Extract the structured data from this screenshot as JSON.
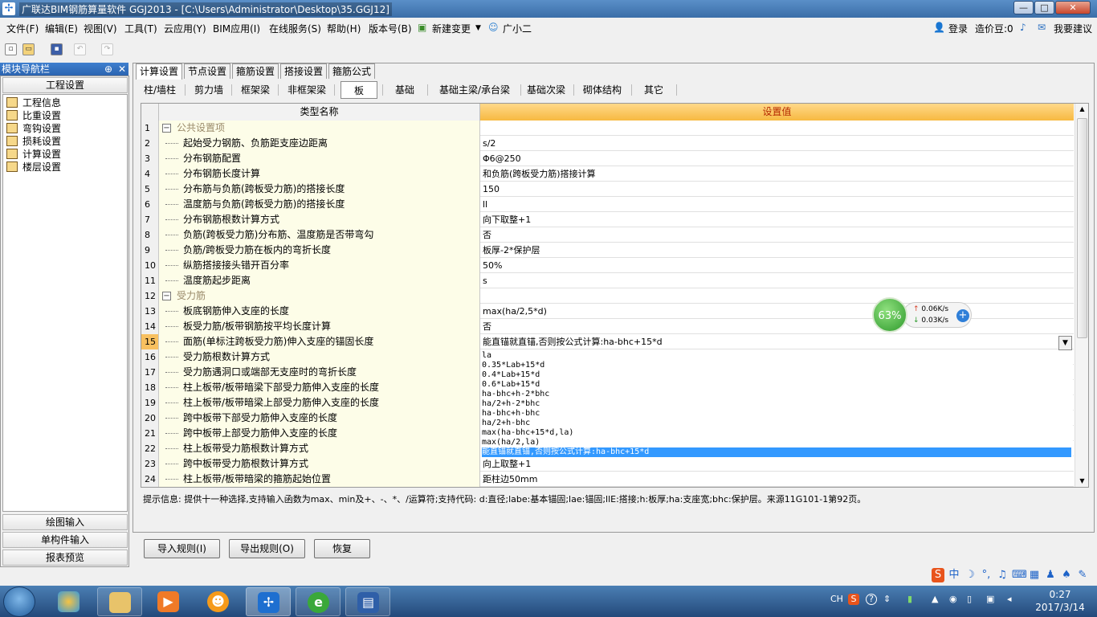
{
  "window": {
    "title": "广联达BIM钢筋算量软件 GGJ2013 - [C:\\Users\\Administrator\\Desktop\\35.GGJ12]",
    "min": "—",
    "max": "□",
    "close": "✕"
  },
  "menu": [
    "文件(F)",
    "编辑(E)",
    "视图(V)",
    "工具(T)",
    "云应用(Y)",
    "BIM应用(I)",
    "在线服务(S)",
    "帮助(H)",
    "版本号(B)",
    "新建变更",
    "广小二"
  ],
  "account": {
    "login": "登录",
    "price_bean": "造价豆:0",
    "suggest": "我要建议"
  },
  "nav": {
    "title": "模块导航栏",
    "pin": "⊕",
    "close": "✕",
    "section_project": "工程设置",
    "items": [
      "工程信息",
      "比重设置",
      "弯钩设置",
      "损耗设置",
      "计算设置",
      "楼层设置"
    ],
    "section_drawing": "绘图输入",
    "section_single": "单构件输入",
    "section_report": "报表预览"
  },
  "tabs": [
    "计算设置",
    "节点设置",
    "箍筋设置",
    "搭接设置",
    "箍筋公式"
  ],
  "subtabs": [
    "柱/墙柱",
    "剪力墙",
    "框架梁",
    "非框架梁",
    "板",
    "基础",
    "基础主梁/承台梁",
    "基础次梁",
    "砌体结构",
    "其它"
  ],
  "grid": {
    "header_name": "类型名称",
    "header_value": "设置值",
    "rows": [
      {
        "num": "1",
        "name": "公共设置项",
        "value": "",
        "group": true
      },
      {
        "num": "2",
        "name": "起始受力钢筋、负筋距支座边距离",
        "value": "s/2"
      },
      {
        "num": "3",
        "name": "分布钢筋配置",
        "value": "Φ6@250"
      },
      {
        "num": "4",
        "name": "分布钢筋长度计算",
        "value": "和负筋(跨板受力筋)搭接计算"
      },
      {
        "num": "5",
        "name": "分布筋与负筋(跨板受力筋)的搭接长度",
        "value": "150"
      },
      {
        "num": "6",
        "name": "温度筋与负筋(跨板受力筋)的搭接长度",
        "value": "ll"
      },
      {
        "num": "7",
        "name": "分布钢筋根数计算方式",
        "value": "向下取整+1"
      },
      {
        "num": "8",
        "name": "负筋(跨板受力筋)分布筋、温度筋是否带弯勾",
        "value": "否"
      },
      {
        "num": "9",
        "name": "负筋/跨板受力筋在板内的弯折长度",
        "value": "板厚-2*保护层"
      },
      {
        "num": "10",
        "name": "纵筋搭接接头错开百分率",
        "value": "50%"
      },
      {
        "num": "11",
        "name": "温度筋起步距离",
        "value": "s"
      },
      {
        "num": "12",
        "name": "受力筋",
        "value": "",
        "group": true
      },
      {
        "num": "13",
        "name": "板底钢筋伸入支座的长度",
        "value": "max(ha/2,5*d)"
      },
      {
        "num": "14",
        "name": "板受力筋/板带钢筋按平均长度计算",
        "value": "否"
      },
      {
        "num": "15",
        "name": "面筋(单标注跨板受力筋)伸入支座的锚固长度",
        "value": "能直锚就直锚,否则按公式计算:ha-bhc+15*d",
        "selected": true
      },
      {
        "num": "16",
        "name": "受力筋根数计算方式",
        "value": ""
      },
      {
        "num": "17",
        "name": "受力筋遇洞口或端部无支座时的弯折长度",
        "value": ""
      },
      {
        "num": "18",
        "name": "柱上板带/板带暗梁下部受力筋伸入支座的长度",
        "value": ""
      },
      {
        "num": "19",
        "name": "柱上板带/板带暗梁上部受力筋伸入支座的长度",
        "value": ""
      },
      {
        "num": "20",
        "name": "跨中板带下部受力筋伸入支座的长度",
        "value": ""
      },
      {
        "num": "21",
        "name": "跨中板带上部受力筋伸入支座的长度",
        "value": ""
      },
      {
        "num": "22",
        "name": "柱上板带受力筋根数计算方式",
        "value": ""
      },
      {
        "num": "23",
        "name": "跨中板带受力筋根数计算方式",
        "value": "向上取整+1"
      },
      {
        "num": "24",
        "name": "柱上板带/板带暗梁的箍筋起始位置",
        "value": "距柱边50mm"
      }
    ]
  },
  "dropdown_options": [
    "la",
    "0.35*Lab+15*d",
    "0.4*Lab+15*d",
    "0.6*Lab+15*d",
    "ha-bhc+h-2*bhc",
    "ha/2+h-2*bhc",
    "ha-bhc+h-bhc",
    "ha/2+h-bhc",
    "max(ha-bhc+15*d,la)",
    "max(ha/2,la)",
    "能直锚就直锚,否则按公式计算:ha-bhc+15*d"
  ],
  "hint": "提示信息: 提供十一种选择,支持输入函数为max、min及+、-、*、/运算符;支持代码: d:直径;labe:基本锚固;lae:锚固;llE:搭接;h:板厚;ha:支座宽;bhc:保护层。来源11G101-1第92页。",
  "buttons": {
    "import": "导入规则(I)",
    "export": "导出规则(O)",
    "restore": "恢复"
  },
  "net_widget": {
    "percent": "63%",
    "up": "0.06K/s",
    "down": "0.03K/s",
    "plus": "+"
  },
  "taskbar": {
    "lang": "CH",
    "time": "0:27",
    "date": "2017/3/14"
  }
}
